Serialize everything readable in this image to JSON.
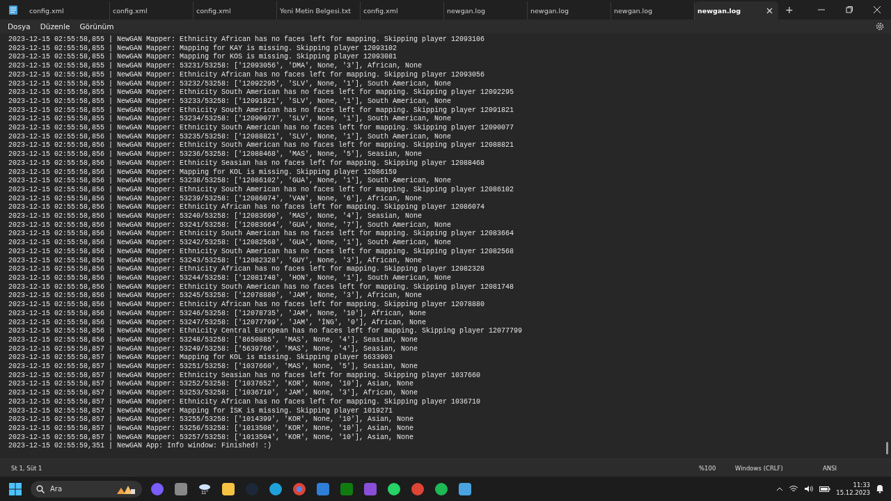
{
  "tabs": [
    {
      "label": "config.xml",
      "selected": false
    },
    {
      "label": "config.xml",
      "selected": false
    },
    {
      "label": "config.xml",
      "selected": false
    },
    {
      "label": "Yeni Metin Belgesi.txt",
      "selected": false
    },
    {
      "label": "config.xml",
      "selected": false
    },
    {
      "label": "newgan.log",
      "selected": false
    },
    {
      "label": "newgan.log",
      "selected": false
    },
    {
      "label": "newgan.log",
      "selected": false
    },
    {
      "label": "newgan.log",
      "selected": true
    }
  ],
  "new_tab": "+",
  "menu": [
    "Dosya",
    "Düzenle",
    "Görünüm"
  ],
  "lines": [
    "2023-12-15 02:55:58,855 | NewGAN Mapper: Ethnicity African has no faces left for mapping. Skipping player 12093106",
    "2023-12-15 02:55:58,855 | NewGAN Mapper: Mapping for KAY is missing. Skipping player 12093102",
    "2023-12-15 02:55:58,855 | NewGAN Mapper: Mapping for KOS is missing. Skipping player 12093081",
    "2023-12-15 02:55:58,855 | NewGAN Mapper: 53231/53258: ['12093056', 'DMA', None, '3'], African, None",
    "2023-12-15 02:55:58,855 | NewGAN Mapper: Ethnicity African has no faces left for mapping. Skipping player 12093056",
    "2023-12-15 02:55:58,855 | NewGAN Mapper: 53232/53258: ['12092295', 'SLV', None, '1'], South American, None",
    "2023-12-15 02:55:58,855 | NewGAN Mapper: Ethnicity South American has no faces left for mapping. Skipping player 12092295",
    "2023-12-15 02:55:58,855 | NewGAN Mapper: 53233/53258: ['12091821', 'SLV', None, '1'], South American, None",
    "2023-12-15 02:55:58,855 | NewGAN Mapper: Ethnicity South American has no faces left for mapping. Skipping player 12091821",
    "2023-12-15 02:55:58,855 | NewGAN Mapper: 53234/53258: ['12090077', 'SLV', None, '1'], South American, None",
    "2023-12-15 02:55:58,855 | NewGAN Mapper: Ethnicity South American has no faces left for mapping. Skipping player 12090077",
    "2023-12-15 02:55:58,856 | NewGAN Mapper: 53235/53258: ['12088821', 'SLV', None, '1'], South American, None",
    "2023-12-15 02:55:58,856 | NewGAN Mapper: Ethnicity South American has no faces left for mapping. Skipping player 12088821",
    "2023-12-15 02:55:58,856 | NewGAN Mapper: 53236/53258: ['12088468', 'MAS', None, '5'], Seasian, None",
    "2023-12-15 02:55:58,856 | NewGAN Mapper: Ethnicity Seasian has no faces left for mapping. Skipping player 12088468",
    "2023-12-15 02:55:58,856 | NewGAN Mapper: Mapping for KOL is missing. Skipping player 12086159",
    "2023-12-15 02:55:58,856 | NewGAN Mapper: 53238/53258: ['12086102', 'GUA', None, '1'], South American, None",
    "2023-12-15 02:55:58,856 | NewGAN Mapper: Ethnicity South American has no faces left for mapping. Skipping player 12086102",
    "2023-12-15 02:55:58,856 | NewGAN Mapper: 53239/53258: ['12086074', 'VAN', None, '6'], African, None",
    "2023-12-15 02:55:58,856 | NewGAN Mapper: Ethnicity African has no faces left for mapping. Skipping player 12086074",
    "2023-12-15 02:55:58,856 | NewGAN Mapper: 53240/53258: ['12083690', 'MAS', None, '4'], Seasian, None",
    "2023-12-15 02:55:58,856 | NewGAN Mapper: 53241/53258: ['12083664', 'GUA', None, '7'], South American, None",
    "2023-12-15 02:55:58,856 | NewGAN Mapper: Ethnicity South American has no faces left for mapping. Skipping player 12083664",
    "2023-12-15 02:55:58,856 | NewGAN Mapper: 53242/53258: ['12082568', 'GUA', None, '1'], South American, None",
    "2023-12-15 02:55:58,856 | NewGAN Mapper: Ethnicity South American has no faces left for mapping. Skipping player 12082568",
    "2023-12-15 02:55:58,856 | NewGAN Mapper: 53243/53258: ['12082328', 'GUY', None, '3'], African, None",
    "2023-12-15 02:55:58,856 | NewGAN Mapper: Ethnicity African has no faces left for mapping. Skipping player 12082328",
    "2023-12-15 02:55:58,856 | NewGAN Mapper: 53244/53258: ['12081748', 'HON', None, '1'], South American, None",
    "2023-12-15 02:55:58,856 | NewGAN Mapper: Ethnicity South American has no faces left for mapping. Skipping player 12081748",
    "2023-12-15 02:55:58,856 | NewGAN Mapper: 53245/53258: ['12078880', 'JAM', None, '3'], African, None",
    "2023-12-15 02:55:58,856 | NewGAN Mapper: Ethnicity African has no faces left for mapping. Skipping player 12078880",
    "2023-12-15 02:55:58,856 | NewGAN Mapper: 53246/53258: ['12078735', 'JAM', None, '10'], African, None",
    "2023-12-15 02:55:58,856 | NewGAN Mapper: 53247/53258: ['12077799', 'JAM', 'İNG', '0'], African, None",
    "2023-12-15 02:55:58,856 | NewGAN Mapper: Ethnicity Central European has no faces left for mapping. Skipping player 12077799",
    "2023-12-15 02:55:58,856 | NewGAN Mapper: 53248/53258: ['8650885', 'MAS', None, '4'], Seasian, None",
    "2023-12-15 02:55:58,857 | NewGAN Mapper: 53249/53258: ['5639766', 'MAS', None, '4'], Seasian, None",
    "2023-12-15 02:55:58,857 | NewGAN Mapper: Mapping for KOL is missing. Skipping player 5633903",
    "2023-12-15 02:55:58,857 | NewGAN Mapper: 53251/53258: ['1037660', 'MAS', None, '5'], Seasian, None",
    "2023-12-15 02:55:58,857 | NewGAN Mapper: Ethnicity Seasian has no faces left for mapping. Skipping player 1037660",
    "2023-12-15 02:55:58,857 | NewGAN Mapper: 53252/53258: ['1037652', 'KOR', None, '10'], Asian, None",
    "2023-12-15 02:55:58,857 | NewGAN Mapper: 53253/53258: ['1036710', 'JAM', None, '3'], African, None",
    "2023-12-15 02:55:58,857 | NewGAN Mapper: Ethnicity African has no faces left for mapping. Skipping player 1036710",
    "2023-12-15 02:55:58,857 | NewGAN Mapper: Mapping for İSK is missing. Skipping player 1019271",
    "2023-12-15 02:55:58,857 | NewGAN Mapper: 53255/53258: ['1014399', 'KOR', None, '10'], Asian, None",
    "2023-12-15 02:55:58,857 | NewGAN Mapper: 53256/53258: ['1013508', 'KOR', None, '10'], Asian, None",
    "2023-12-15 02:55:58,857 | NewGAN Mapper: 53257/53258: ['1013504', 'KOR', None, '10'], Asian, None",
    "2023-12-15 02:55:59,351 | NewGAN App: Info window: Finished! :)"
  ],
  "status_bar": {
    "position": "St 1, Süt 1",
    "zoom": "%100",
    "line_ending": "Windows (CRLF)",
    "encoding": "ANSI"
  },
  "taskbar": {
    "search_placeholder": "Ara",
    "weather": "11°",
    "time": "11:33",
    "date": "15.12.2023"
  }
}
